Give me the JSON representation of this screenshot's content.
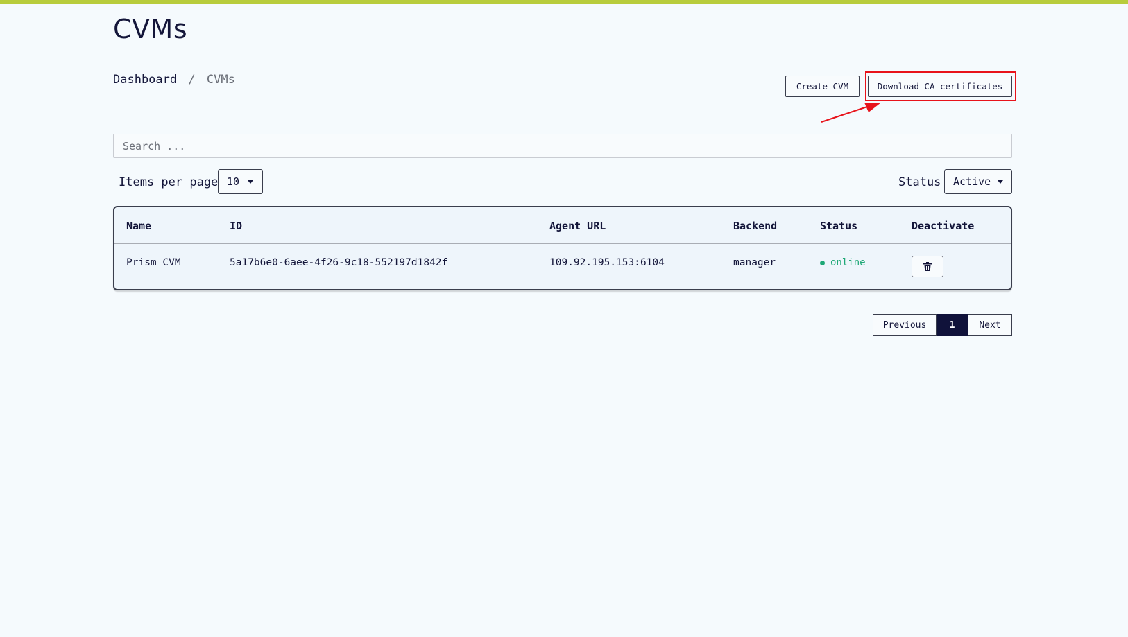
{
  "header": {
    "title": "CVMs"
  },
  "breadcrumb": {
    "home": "Dashboard",
    "separator": "/",
    "current": "CVMs"
  },
  "actions": {
    "create_label": "Create CVM",
    "download_label": "Download CA certificates"
  },
  "search": {
    "placeholder": "Search ...",
    "value": ""
  },
  "filters": {
    "items_per_page_label": "Items per page",
    "items_per_page_value": "10",
    "status_label": "Status",
    "status_value": "Active"
  },
  "table": {
    "columns": [
      "Name",
      "ID",
      "Agent URL",
      "Backend",
      "Status",
      "Deactivate"
    ],
    "rows": [
      {
        "name": "Prism CVM",
        "id": "5a17b6e0-6aee-4f26-9c18-552197d1842f",
        "agent_url": "109.92.195.153:6104",
        "backend": "manager",
        "status": "online",
        "deactivate_icon": "trash-icon"
      }
    ]
  },
  "pagination": {
    "previous": "Previous",
    "current_page": "1",
    "next": "Next"
  },
  "colors": {
    "accent_bar": "#b8cc3c",
    "online": "#1ea876",
    "highlight": "#e8131b",
    "active_page": "#10123a"
  }
}
